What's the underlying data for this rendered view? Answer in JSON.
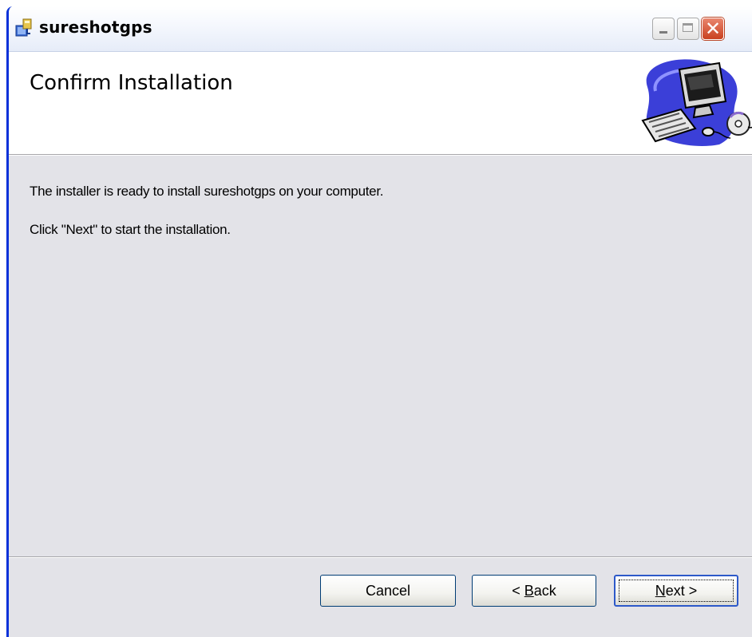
{
  "window": {
    "title": "sureshotgps",
    "controls": {
      "minimize": "minimize-button",
      "maximize": "maximize-button",
      "close": "close-button"
    }
  },
  "banner": {
    "title": "Confirm Installation",
    "art_icon": "computer-cd-icon"
  },
  "content": {
    "line1": "The installer is ready to install sureshotgps on your computer.",
    "line2": "Click \"Next\" to start the installation."
  },
  "footer": {
    "cancel_label": "Cancel",
    "back_label_prefix": "< ",
    "back_label_accel": "B",
    "back_label_rest": "ack",
    "next_label_accel": "N",
    "next_label_rest": "ext >"
  },
  "colors": {
    "window_border": "#0831d9",
    "close_button": "#c9401f",
    "panel_bg": "#e3e3e8",
    "banner_bg": "#ffffff"
  }
}
